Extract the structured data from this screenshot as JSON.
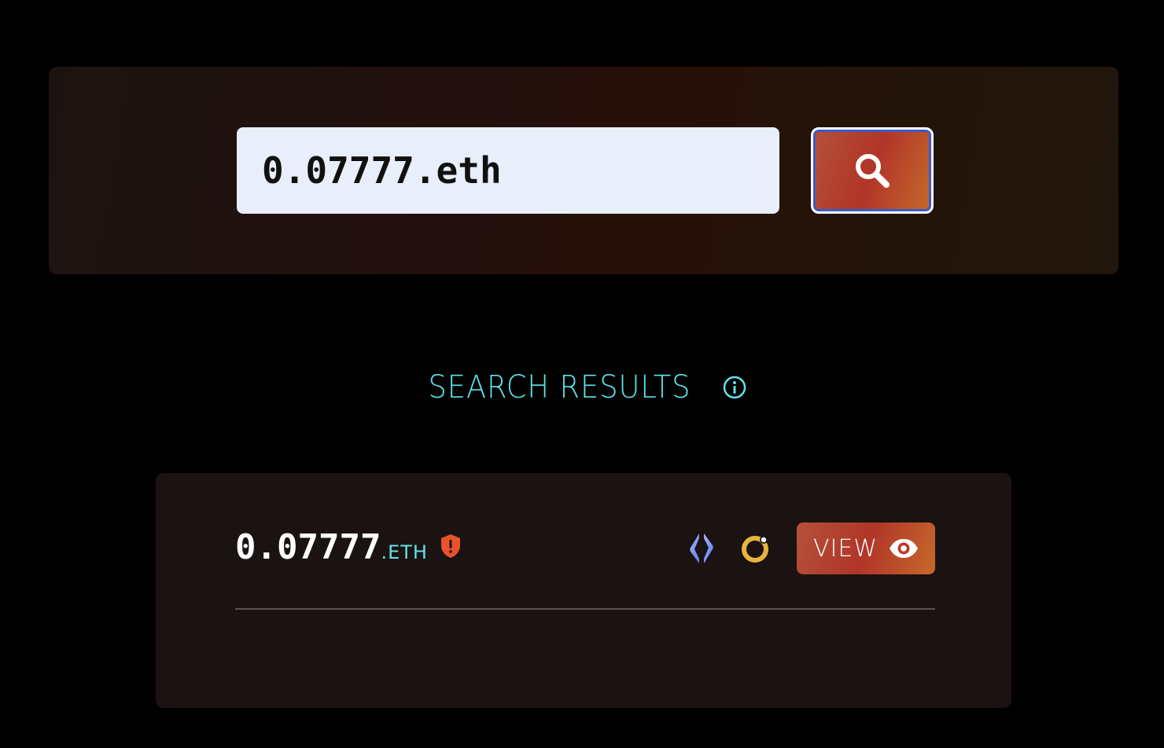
{
  "search": {
    "value": "0.07777.eth",
    "button_icon": "search-icon"
  },
  "results": {
    "title": "SEARCH RESULTS",
    "info_icon": "info-icon",
    "items": [
      {
        "name": "0.07777",
        "tld": ".ETH",
        "badge_icon": "shield-alert-icon",
        "badge_color": "#e8532c",
        "protocol_icons": [
          "ens-icon",
          "ring-logo-icon"
        ],
        "view_label": "VIEW",
        "view_icon": "eye-icon"
      }
    ]
  },
  "colors": {
    "accent_cyan": "#5fe3ec",
    "button_gradient_start": "#b4513a",
    "button_gradient_mid": "#b13528",
    "button_gradient_end": "#c56a2b",
    "input_bg": "#e8effb",
    "card_bg": "#1b1312"
  }
}
